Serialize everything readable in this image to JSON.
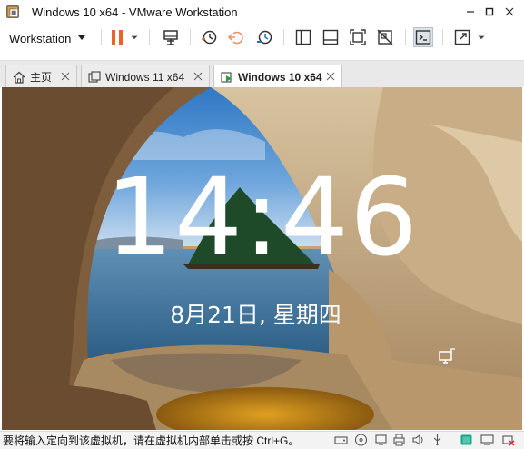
{
  "window": {
    "title": "Windows 10 x64 - VMware Workstation",
    "controls": [
      "minimize",
      "maximize",
      "close"
    ]
  },
  "toolbar": {
    "menu_label": "Workstation",
    "icons": [
      "pause-icon",
      "send-ctrl-alt-del-icon",
      "snapshot-take-icon",
      "snapshot-revert-icon",
      "snapshot-manager-icon",
      "show-library-icon",
      "show-thumbnail-bar-icon",
      "full-screen-icon",
      "unity-icon",
      "console-view-icon",
      "stretch-view-icon"
    ],
    "accent": "#e8642c"
  },
  "tabs": [
    {
      "label": "主页",
      "icon": "home-icon",
      "active": false
    },
    {
      "label": "Windows 11 x64",
      "icon": "vm-icon",
      "active": false
    },
    {
      "label": "Windows 10 x64",
      "icon": "vm-running-icon",
      "active": true
    }
  ],
  "lockscreen": {
    "time": "14:46",
    "date": "8月21日, 星期四",
    "network_icon": "network-icon"
  },
  "statusbar": {
    "message": "要将输入定向到该虚拟机，请在虚拟机内部单击或按 Ctrl+G。",
    "icons": [
      "hard-disk-icon",
      "cd-icon",
      "network-adapter-icon",
      "usb-icon",
      "printer-icon",
      "sound-icon",
      "display-icon",
      "message-icon",
      "usb-disconnected-icon"
    ]
  }
}
